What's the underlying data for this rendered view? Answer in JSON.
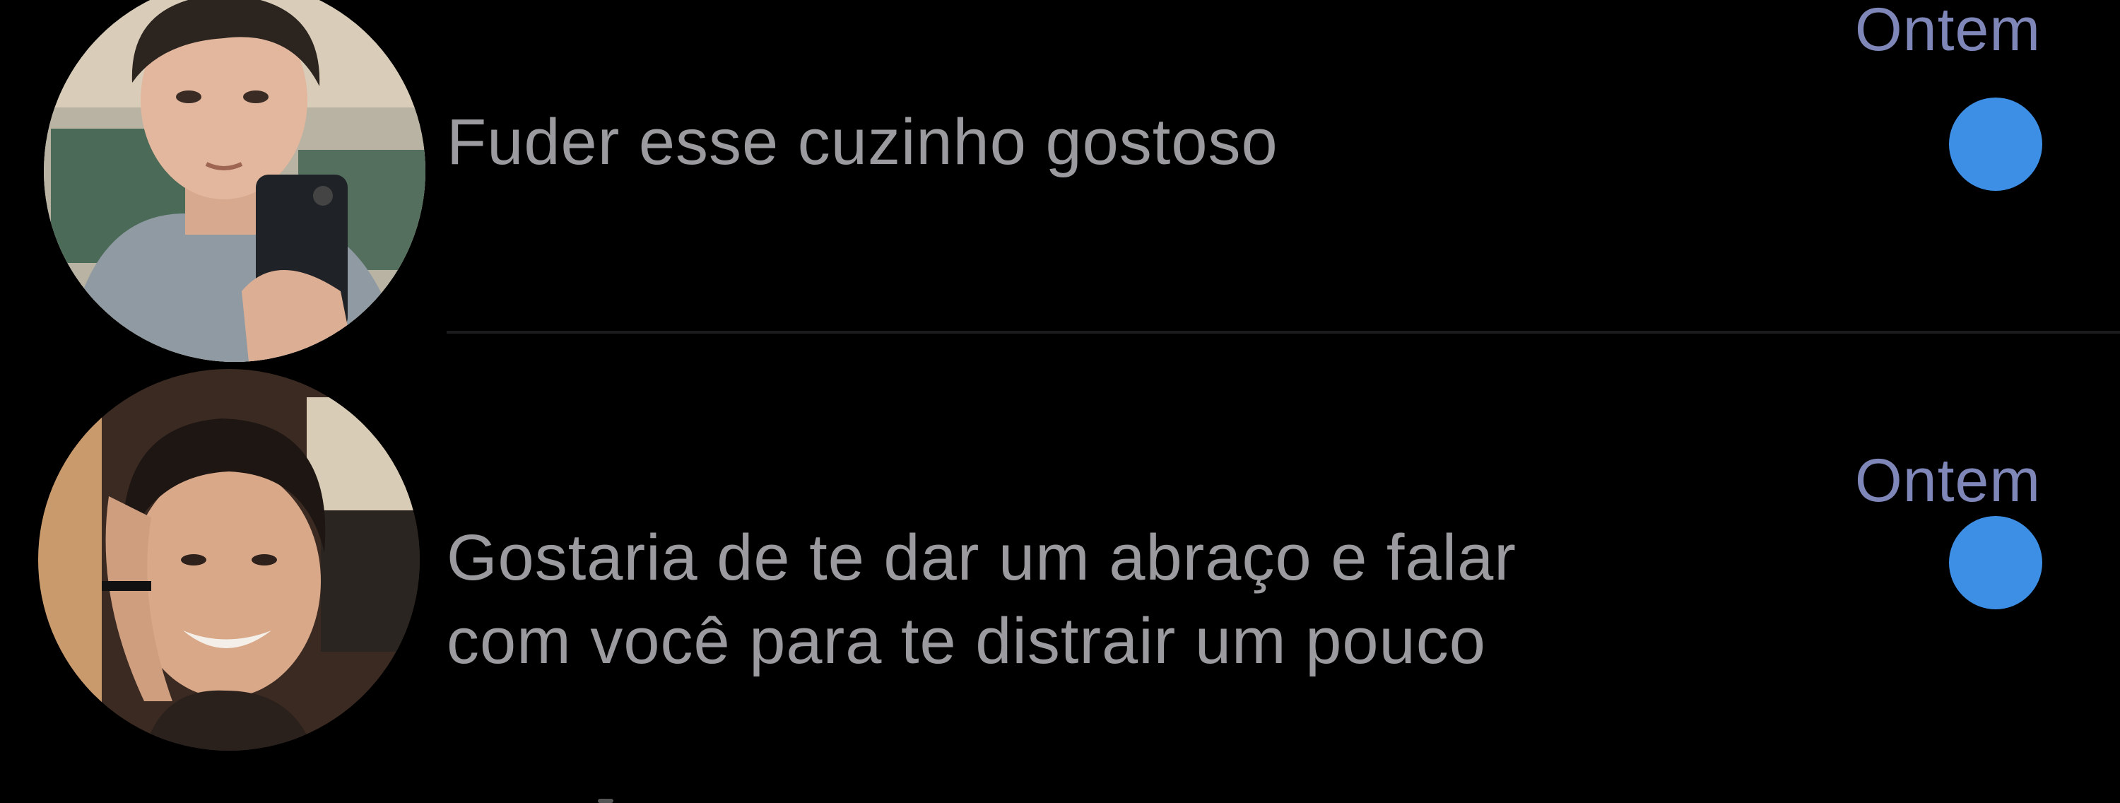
{
  "conversations": [
    {
      "avatar_icon": "contact-photo-icon",
      "timestamp": "Ontem",
      "preview_lines": [
        "Fuder esse cuzinho gostoso"
      ],
      "unread": true
    },
    {
      "avatar_icon": "contact-photo-icon",
      "timestamp": "Ontem",
      "preview_lines": [
        "Gostaria de te dar um abraço e falar",
        "com você para te distrair um pouco"
      ],
      "unread": true
    }
  ],
  "colors": {
    "background": "#000000",
    "preview_text": "#9b9b9f",
    "timestamp": "#7f86b8",
    "unread_dot": "#3d8fe6",
    "separator": "#1b1b1d"
  }
}
